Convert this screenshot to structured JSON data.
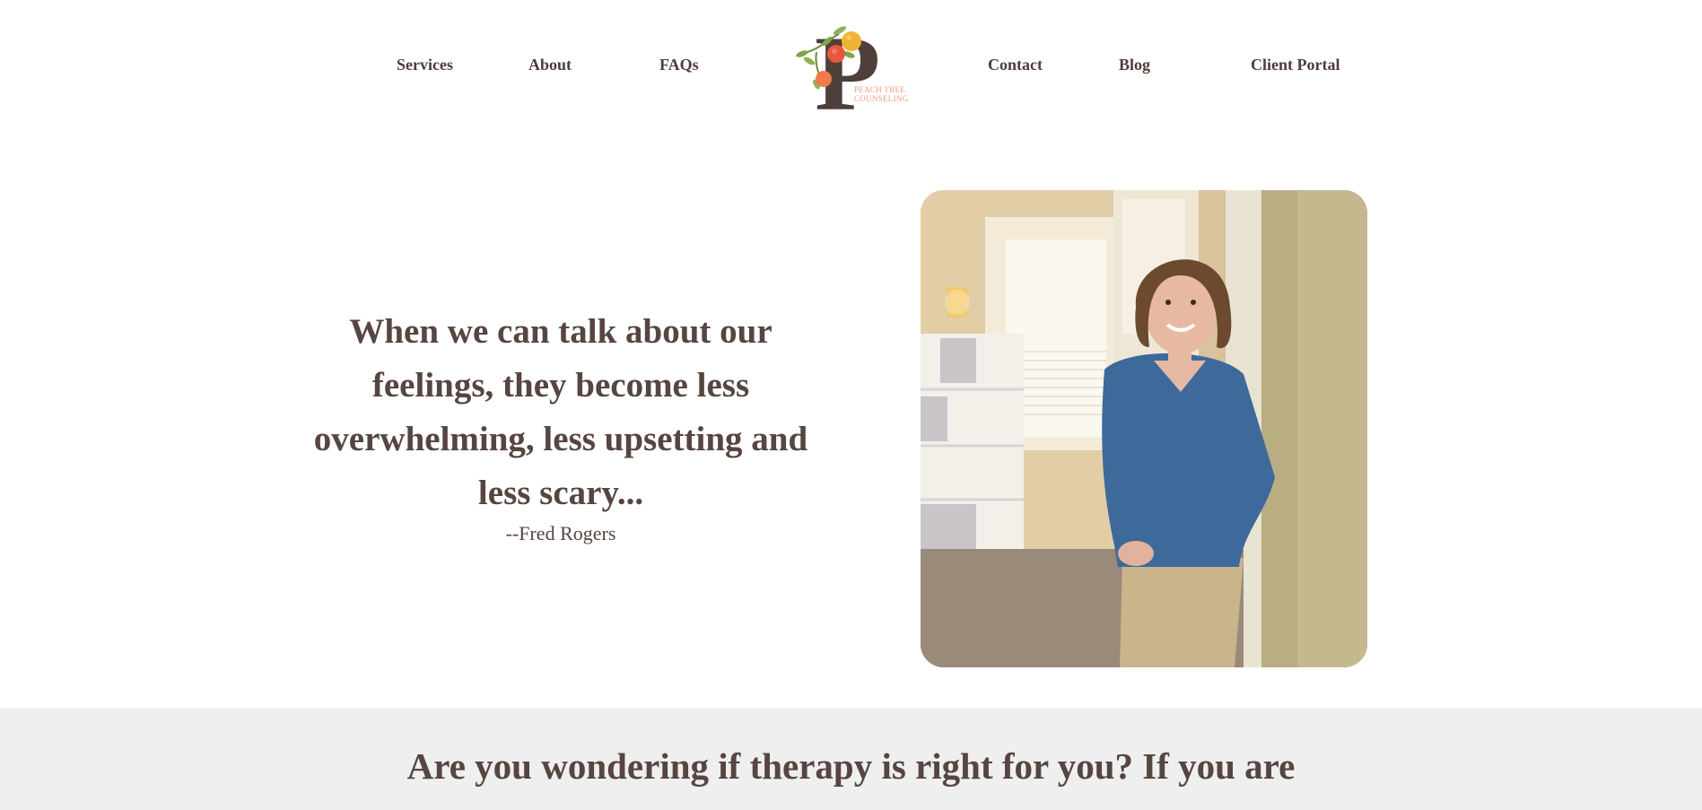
{
  "nav": {
    "services": "Services",
    "about": "About",
    "faqs": "FAQs",
    "contact": "Contact",
    "blog": "Blog",
    "client_portal": "Client Portal"
  },
  "logo": {
    "letter": "P",
    "line1": "PEACH TREE",
    "line2": "COUNSELING"
  },
  "hero": {
    "quote": "When we can talk about our feelings, they become less overwhelming, less upsetting and less scary...",
    "attribution": "--Fred Rogers"
  },
  "section": {
    "heading": "Are you wondering if therapy is right for you? If you are"
  },
  "colors": {
    "text": "#564540",
    "accent_peach": "#f0a080",
    "band_bg": "#efefef"
  }
}
